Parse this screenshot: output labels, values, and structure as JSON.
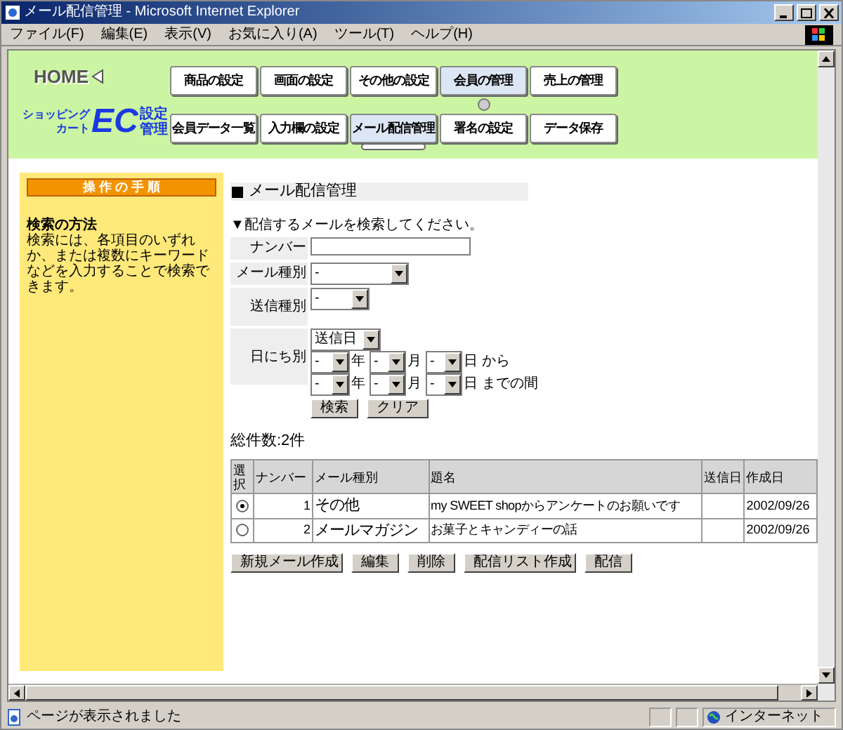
{
  "window": {
    "title": "メール配信管理 - Microsoft Internet Explorer"
  },
  "menu": [
    "ファイル(F)",
    "編集(E)",
    "表示(V)",
    "お気に入り(A)",
    "ツール(T)",
    "ヘルプ(H)"
  ],
  "header": {
    "home": "HOME",
    "logo": {
      "line1": "ショッピング",
      "line2": "カート",
      "mark": "EC",
      "side1": "設定",
      "side2": "管理"
    }
  },
  "nav_top": [
    {
      "label": "商品の設定",
      "selected": false
    },
    {
      "label": "画面の設定",
      "selected": false
    },
    {
      "label": "その他の設定",
      "selected": false
    },
    {
      "label": "会員の管理",
      "selected": true
    },
    {
      "label": "売上の管理",
      "selected": false
    }
  ],
  "nav_sub": [
    {
      "label": "会員データ一覧",
      "selected": false
    },
    {
      "label": "入力欄の設定",
      "selected": false
    },
    {
      "label": "メール配信管理",
      "selected": true
    },
    {
      "label": "署名の設定",
      "selected": false
    },
    {
      "label": "データ保存",
      "selected": false
    }
  ],
  "sidebar": {
    "heading": "操 作 の 手 順",
    "title": "検索の方法",
    "body": "検索には、各項目のいずれか、または複数にキーワードなどを入力することで検索できます。"
  },
  "page_title": "メール配信管理",
  "search": {
    "prompt": "▼配信するメールを検索してください。",
    "number": {
      "label": "ナンバー"
    },
    "mail_type": {
      "label": "メール種別",
      "value": "-"
    },
    "send_type": {
      "label": "送信種別",
      "value": "-"
    },
    "date": {
      "label": "日にち別",
      "mode": "送信日",
      "ranges": [
        {
          "year": "-",
          "year_unit": "年",
          "month": "-",
          "month_unit": "月",
          "day": "-",
          "day_unit": "日",
          "suffix": "から"
        },
        {
          "year": "-",
          "year_unit": "年",
          "month": "-",
          "month_unit": "月",
          "day": "-",
          "day_unit": "日",
          "suffix": "までの間"
        }
      ]
    },
    "buttons": [
      "検索",
      "クリア"
    ]
  },
  "total": "総件数:2件",
  "table": {
    "columns": [
      "選択",
      "ナンバー",
      "メール種別",
      "題名",
      "送信日",
      "作成日"
    ],
    "rows": [
      {
        "selected": true,
        "number": "1",
        "type": "その他",
        "subject": "my SWEET shopからアンケートのお願いです",
        "created": "2002/09/26"
      },
      {
        "selected": false,
        "number": "2",
        "type": "メールマガジン",
        "subject": "お菓子とキャンディーの話",
        "created": "2002/09/26"
      }
    ]
  },
  "actions": [
    "新規メール作成",
    "編集",
    "削除",
    "配信リスト作成",
    "配信"
  ],
  "status_bar": {
    "text": "ページが表示されました",
    "zone": "インターネット"
  }
}
